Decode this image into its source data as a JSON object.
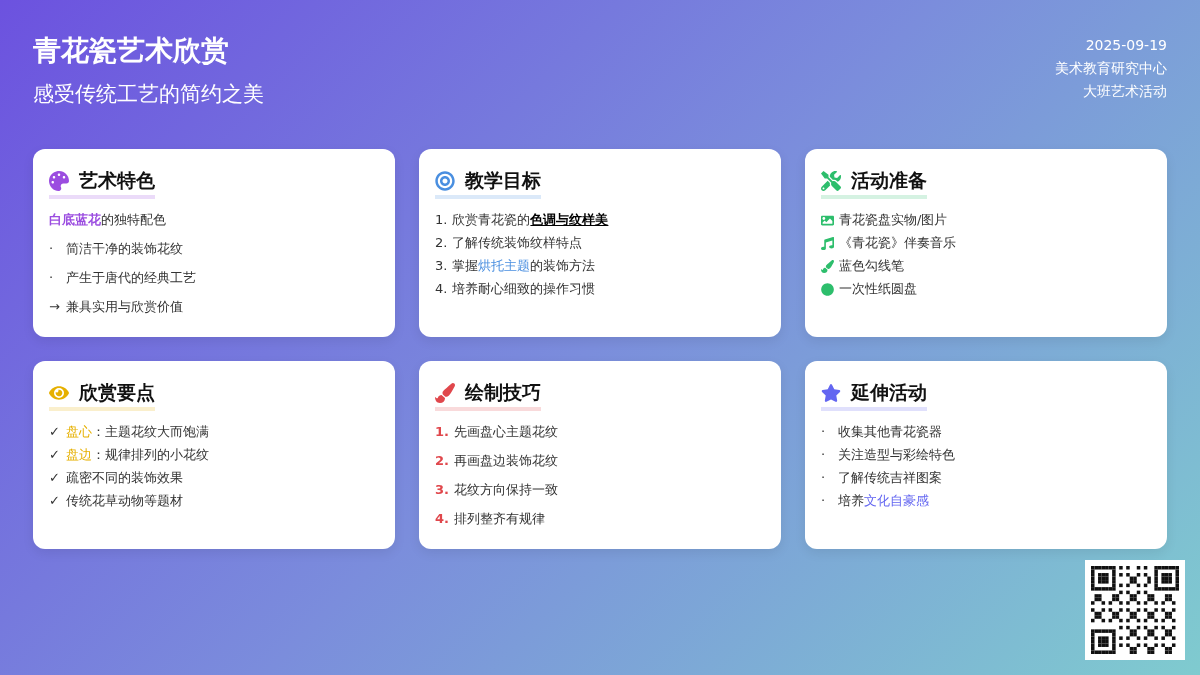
{
  "header": {
    "title": "青花瓷艺术欣赏",
    "subtitle": "感受传统工艺的简约之美",
    "meta": [
      "2025-09-19",
      "美术教育研究中心",
      "大班艺术活动"
    ]
  },
  "cards": [
    {
      "title": "艺术特色",
      "color": "#9b4de0",
      "items": [
        {
          "segments": [
            {
              "kind": "accent",
              "text": "白底蓝花"
            },
            {
              "kind": "plain",
              "text": "的独特配色"
            }
          ]
        },
        {
          "marker": "·",
          "segments": [
            {
              "kind": "plain",
              "text": "简洁干净的装饰花纹"
            }
          ]
        },
        {
          "marker": "·",
          "segments": [
            {
              "kind": "plain",
              "text": "产生于唐代的经典工艺"
            }
          ]
        },
        {
          "marker": "→",
          "segments": [
            {
              "kind": "plain",
              "text": "兼具实用与欣赏价值"
            }
          ]
        }
      ]
    },
    {
      "title": "教学目标",
      "color": "#4a8fe0",
      "items": [
        {
          "marker": "1.",
          "segments": [
            {
              "kind": "plain",
              "text": "欣赏青花瓷的"
            },
            {
              "kind": "emphasis",
              "text": "色调与纹样美"
            }
          ]
        },
        {
          "marker": "2.",
          "segments": [
            {
              "kind": "plain",
              "text": "了解传统装饰纹样特点"
            }
          ]
        },
        {
          "marker": "3.",
          "segments": [
            {
              "kind": "plain",
              "text": "掌握"
            },
            {
              "kind": "accent",
              "text": "烘托主题"
            },
            {
              "kind": "plain",
              "text": "的装饰方法"
            }
          ]
        },
        {
          "marker": "4.",
          "segments": [
            {
              "kind": "plain",
              "text": "培养耐心细致的操作习惯"
            }
          ]
        }
      ]
    },
    {
      "title": "活动准备",
      "color": "#2dbe6c",
      "items": [
        {
          "segments": [
            {
              "kind": "plain",
              "text": "青花瓷盘实物/图片"
            }
          ]
        },
        {
          "segments": [
            {
              "kind": "plain",
              "text": "《青花瓷》伴奏音乐"
            }
          ]
        },
        {
          "segments": [
            {
              "kind": "plain",
              "text": "蓝色勾线笔"
            }
          ]
        },
        {
          "segments": [
            {
              "kind": "plain",
              "text": "一次性纸圆盘"
            }
          ]
        }
      ]
    },
    {
      "title": "欣赏要点",
      "color": "#e6b000",
      "items": [
        {
          "marker": "✓",
          "segments": [
            {
              "kind": "accent",
              "text": "盘心"
            },
            {
              "kind": "plain",
              "text": "：主题花纹大而饱满"
            }
          ]
        },
        {
          "marker": "✓",
          "segments": [
            {
              "kind": "accent",
              "text": "盘边"
            },
            {
              "kind": "plain",
              "text": "：规律排列的小花纹"
            }
          ]
        },
        {
          "marker": "✓",
          "segments": [
            {
              "kind": "plain",
              "text": "疏密不同的装饰效果"
            }
          ]
        },
        {
          "marker": "✓",
          "segments": [
            {
              "kind": "plain",
              "text": "传统花草动物等题材"
            }
          ]
        }
      ]
    },
    {
      "title": "绘制技巧",
      "color": "#e0474c",
      "items": [
        {
          "marker": "1.",
          "segments": [
            {
              "kind": "plain",
              "text": "先画盘心主题花纹"
            }
          ]
        },
        {
          "marker": "2.",
          "segments": [
            {
              "kind": "plain",
              "text": "再画盘边装饰花纹"
            }
          ]
        },
        {
          "marker": "3.",
          "segments": [
            {
              "kind": "plain",
              "text": "花纹方向保持一致"
            }
          ]
        },
        {
          "marker": "4.",
          "segments": [
            {
              "kind": "plain",
              "text": "排列整齐有规律"
            }
          ]
        }
      ]
    },
    {
      "title": "延伸活动",
      "color": "#6366f1",
      "items": [
        {
          "marker": "·",
          "segments": [
            {
              "kind": "plain",
              "text": "收集其他青花瓷器"
            }
          ]
        },
        {
          "marker": "·",
          "segments": [
            {
              "kind": "plain",
              "text": "关注造型与彩绘特色"
            }
          ]
        },
        {
          "marker": "·",
          "segments": [
            {
              "kind": "plain",
              "text": "了解传统吉祥图案"
            }
          ]
        },
        {
          "marker": "·",
          "segments": [
            {
              "kind": "plain",
              "text": "培养"
            },
            {
              "kind": "accent",
              "text": "文化自豪感"
            }
          ]
        }
      ]
    }
  ]
}
